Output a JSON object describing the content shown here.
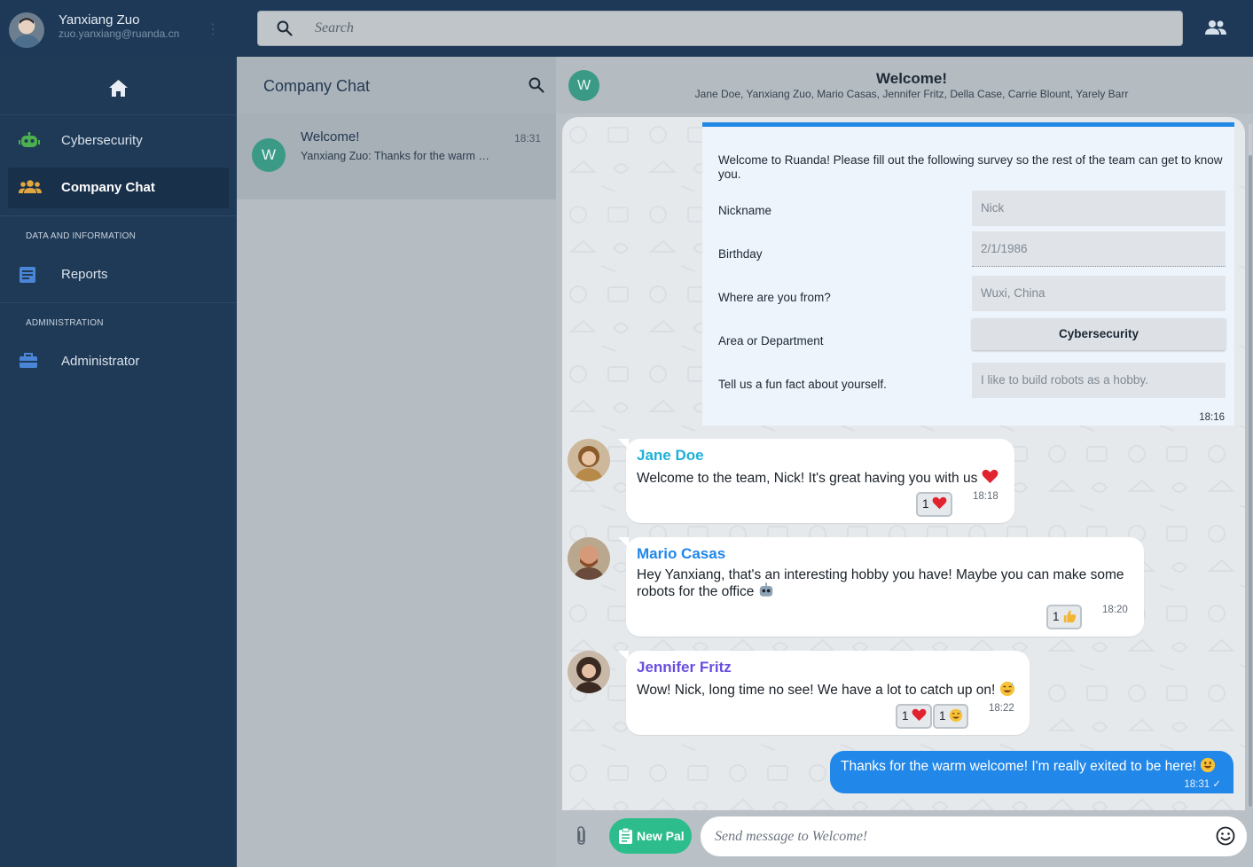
{
  "user": {
    "name": "Yanxiang Zuo",
    "email": "zuo.yanxiang@ruanda.cn",
    "kebab": "⋮"
  },
  "search": {
    "placeholder": "Search"
  },
  "sidebar": {
    "items": [
      {
        "label": "Cybersecurity",
        "icon": "robot-icon",
        "color": "#4caf50"
      },
      {
        "label": "Company Chat",
        "icon": "group-icon",
        "color": "#e0a740",
        "active": true
      },
      {
        "label": "Reports",
        "icon": "document-icon",
        "color": "#4a86d8"
      },
      {
        "label": "Administrator",
        "icon": "toolbox-icon",
        "color": "#4a86d8"
      }
    ],
    "sections": [
      "DATA AND INFORMATION",
      "ADMINISTRATION"
    ]
  },
  "convlist": {
    "title": "Company Chat",
    "items": [
      {
        "avatar": "W",
        "title": "Welcome!",
        "time": "18:31",
        "preview": "Yanxiang Zuo: Thanks for the warm welcome! I'm really exited to be here!"
      }
    ]
  },
  "chat": {
    "avatar": "W",
    "title": "Welcome!",
    "members": "Jane Doe, Yanxiang Zuo, Mario Casas, Jennifer Fritz, Della Case, Carrie Blount, Yarely Barr",
    "survey": {
      "intro": "Welcome to Ruanda! Please fill out the following survey so the rest of the team can get to know you.",
      "q1": "Nickname",
      "a1": "Nick",
      "q2": "Birthday",
      "a2": "2/1/1986",
      "q3": "Where are you from?",
      "a3": "Wuxi, China",
      "q4": "Area or Department",
      "a4": "Cybersecurity",
      "q5": "Tell us a fun fact about yourself.",
      "a5": "I like to build robots as a hobby.",
      "time": "18:16"
    },
    "messages": [
      {
        "from": "Jane Doe",
        "color": "#1fb0d8",
        "text": "Welcome to the team, Nick! It's great having you with us",
        "time": "18:18",
        "reactions": [
          {
            "count": "1",
            "emoji": "heart"
          }
        ]
      },
      {
        "from": "Mario Casas",
        "color": "#2187e8",
        "text": "Hey Yanxiang, that's an interesting hobby you have! Maybe you can make some robots for the office",
        "time": "18:20",
        "reactions": [
          {
            "count": "1",
            "emoji": "thumbs-up"
          }
        ]
      },
      {
        "from": "Jennifer Fritz",
        "color": "#6a4ee0",
        "text": "Wow! Nick, long time no see! We have a lot to catch up on!",
        "time": "18:22",
        "reactions": [
          {
            "count": "1",
            "emoji": "heart"
          },
          {
            "count": "1",
            "emoji": "sweat-smile"
          }
        ]
      }
    ],
    "mine": {
      "text": "Thanks for the warm welcome! I'm really exited to be here!",
      "time": "18:31",
      "tick": "✓"
    }
  },
  "composer": {
    "new_pal": "New Pal",
    "placeholder": "Send message to Welcome!"
  },
  "colors": {
    "accent": "#2187e8",
    "green": "#2dbd8c",
    "sidebar": "#1f3a57"
  }
}
